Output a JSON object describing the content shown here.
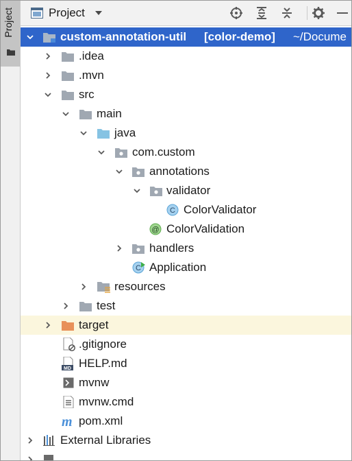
{
  "side_panel": {
    "tab_label": "Project"
  },
  "toolbar": {
    "view_label": "Project"
  },
  "tree": {
    "root": {
      "name": "custom-annotation-util",
      "module": "[color-demo]",
      "path": "~/Docume"
    },
    "idea": ".idea",
    "mvn": ".mvn",
    "src": "src",
    "main": "main",
    "java": "java",
    "com_custom": "com.custom",
    "annotations": "annotations",
    "validator": "validator",
    "color_validator": "ColorValidator",
    "color_validation": "ColorValidation",
    "handlers": "handlers",
    "application": "Application",
    "resources": "resources",
    "test": "test",
    "target": "target",
    "gitignore": ".gitignore",
    "help_md": "HELP.md",
    "mvnw": "mvnw",
    "mvnw_cmd": "mvnw.cmd",
    "pom_xml": "pom.xml",
    "external_libraries": "External Libraries"
  },
  "colors": {
    "selection": "#2f65ca",
    "highlight_row": "#fbf6dd",
    "folder": "#a0a8b2",
    "source_folder": "#86c3e3",
    "target_folder": "#e8915a"
  }
}
